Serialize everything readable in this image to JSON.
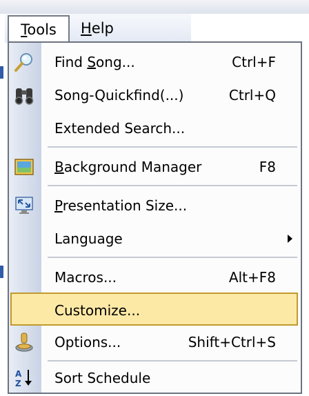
{
  "menubar": {
    "tools": {
      "pre": "",
      "accel": "T",
      "post": "ools"
    },
    "help": {
      "pre": "",
      "accel": "H",
      "post": "elp"
    }
  },
  "menu": {
    "find_song": {
      "pre": "Find ",
      "accel": "S",
      "post": "ong...",
      "shortcut": "Ctrl+F",
      "icon": "magnifier-icon"
    },
    "song_quickfind": {
      "label": "Song-Quickfind(...)",
      "shortcut": "Ctrl+Q",
      "icon": "binoculars-icon"
    },
    "extended_search": {
      "label": "Extended Search..."
    },
    "background_manager": {
      "pre": "",
      "accel": "B",
      "post": "ackground Manager",
      "shortcut": "F8",
      "icon": "picture-frame-icon"
    },
    "presentation_size": {
      "pre": "",
      "accel": "P",
      "post": "resentation Size...",
      "icon": "screen-resize-icon"
    },
    "language": {
      "label": "Language",
      "has_submenu": true
    },
    "macros": {
      "label": "Macros...",
      "shortcut": "Alt+F8"
    },
    "customize": {
      "label": "Customize...",
      "state": "highlighted"
    },
    "options": {
      "label": "Options...",
      "shortcut": "Shift+Ctrl+S",
      "icon": "options-gear-icon"
    },
    "sort_schedule": {
      "label": "Sort Schedule",
      "icon": "sort-az-icon"
    }
  },
  "colors": {
    "highlight_fill": "#fde9a6",
    "highlight_border": "#c09a2e",
    "menu_border": "#6b7280"
  }
}
